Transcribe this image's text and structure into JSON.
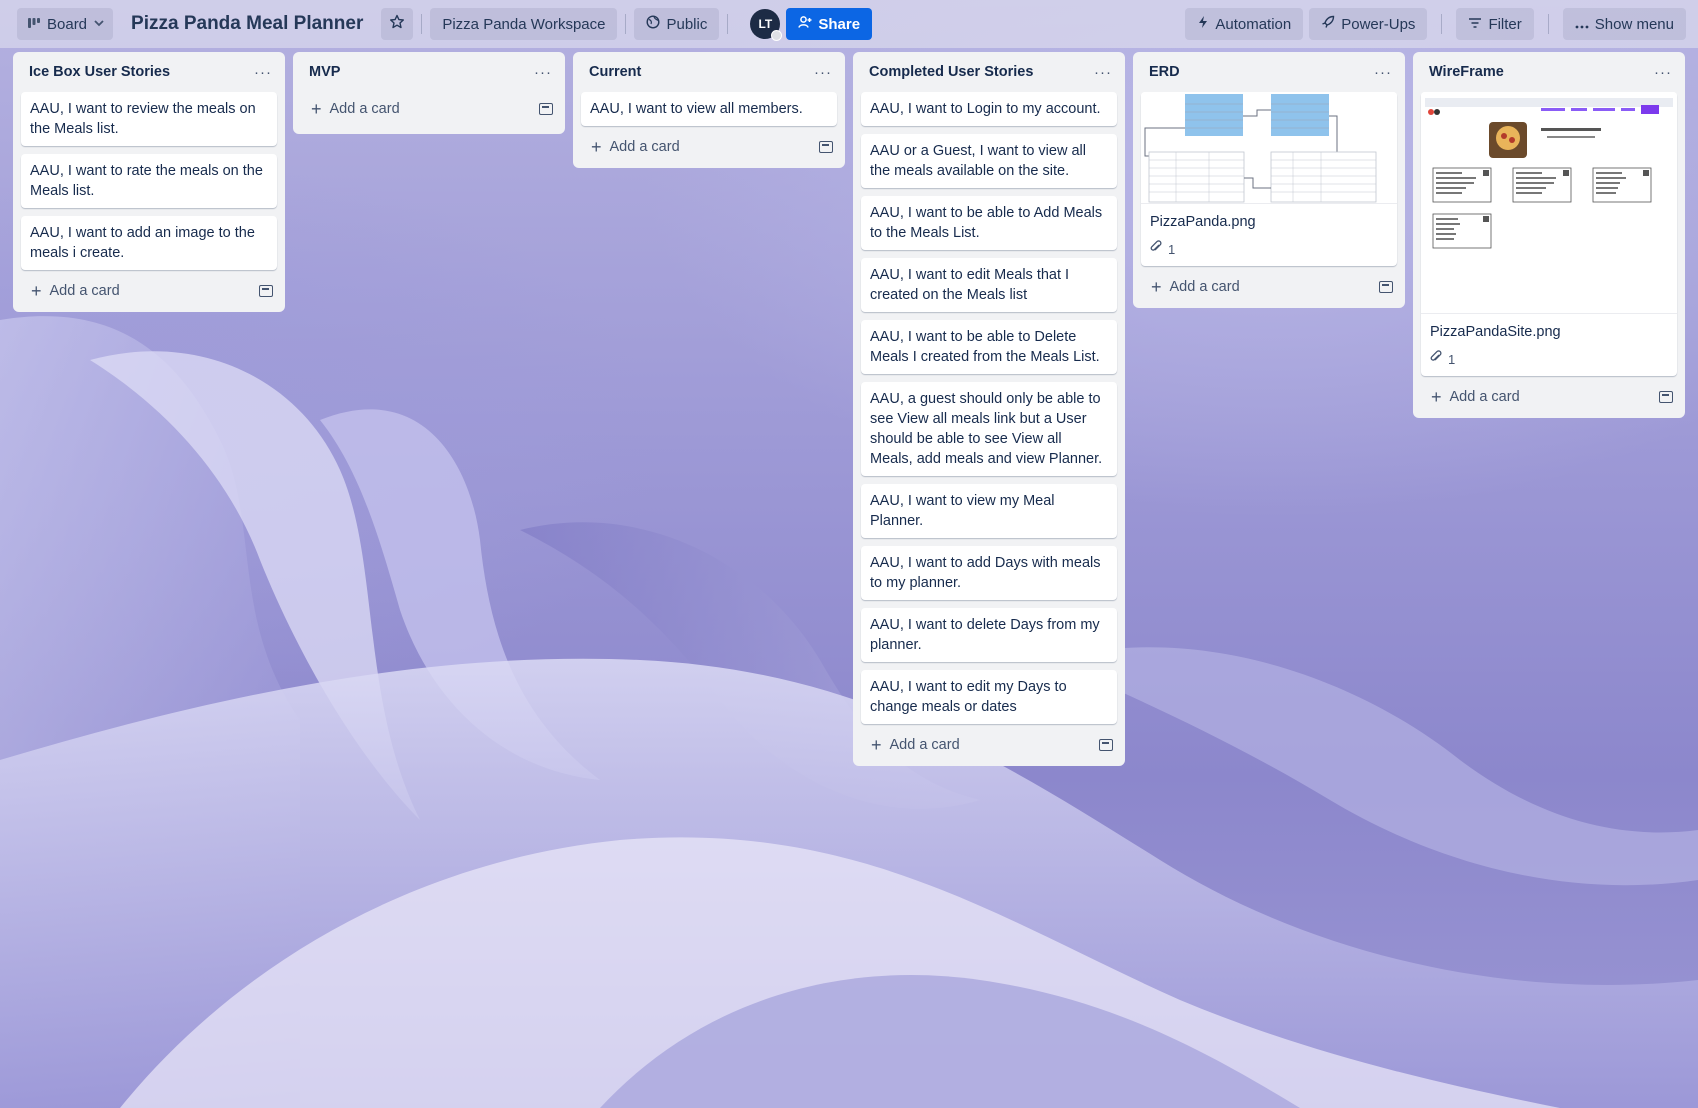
{
  "header": {
    "board_switch_label": "Board",
    "board_title": "Pizza Panda Meal Planner",
    "workspace_label": "Pizza Panda Workspace",
    "visibility_label": "Public",
    "avatar_initials": "LT",
    "share_label": "Share",
    "automation_label": "Automation",
    "powerups_label": "Power-Ups",
    "filter_label": "Filter",
    "show_menu_label": "Show menu"
  },
  "add_card_label": "Add a card",
  "lists": [
    {
      "title": "Ice Box User Stories",
      "cards": [
        "AAU, I want to review the meals on the Meals list.",
        "AAU, I want to rate the meals on the Meals list.",
        "AAU, I want to add an image to the meals i create."
      ]
    },
    {
      "title": "MVP",
      "cards": []
    },
    {
      "title": "Current",
      "cards": [
        "AAU, I want to view all members."
      ]
    },
    {
      "title": "Completed User Stories",
      "cards": [
        "AAU, I want to Login to my account.",
        "AAU or a Guest, I want to view all the meals available on the site.",
        "AAU, I want to be able to Add Meals to the Meals List.",
        "AAU, I want to edit Meals that I created on the Meals list",
        "AAU, I want to be able to Delete Meals I created from the Meals List.",
        "AAU, a guest should only be able to see View all meals link but a User should be able to see View all Meals, add meals and view Planner.",
        "AAU, I want to view my Meal Planner.",
        "AAU, I want to add Days with meals to my planner.",
        "AAU, I want to delete Days from my planner.",
        "AAU, I want to edit my Days to change meals or dates"
      ]
    },
    {
      "title": "ERD",
      "attachment_card": {
        "title": "PizzaPanda.png",
        "attachment_count": "1"
      }
    },
    {
      "title": "WireFrame",
      "attachment_card": {
        "title": "PizzaPandaSite.png",
        "attachment_count": "1"
      }
    }
  ],
  "colors": {
    "share": "#0c66e4",
    "list_bg": "#f1f2f4",
    "text": "#172b4d"
  }
}
